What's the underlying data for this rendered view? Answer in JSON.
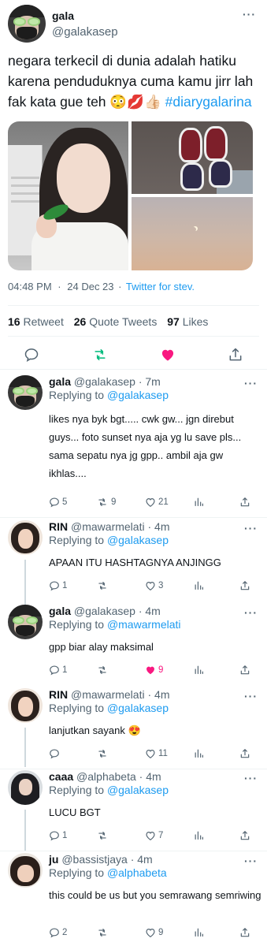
{
  "main_tweet": {
    "author_name": "gala",
    "author_handle": "@galakasep",
    "text_parts": {
      "body": "negara terkecil di dunia adalah hatiku karena penduduknya cuma kamu jirr lah fak kata gue teh 😳💋👍🏻 ",
      "hashtag": "#diarygalarina"
    },
    "time": "04:48 PM",
    "separator": "·",
    "date": "24 Dec 23",
    "source": "Twitter for stev.",
    "stats": [
      {
        "count": "16",
        "label": "Retweet"
      },
      {
        "count": "26",
        "label": "Quote Tweets"
      },
      {
        "count": "97",
        "label": "Likes"
      }
    ],
    "media": [
      "portrait-photo",
      "shoes-photo",
      "sunset-moon-photo"
    ]
  },
  "replies": [
    {
      "name": "gala",
      "handle": "@galakasep",
      "time": "· 7m",
      "replying_label": "Replying to",
      "replying_to": "@galakasep",
      "text": "likes nya byk bgt..... cwk gw... jgn direbut guys... foto sunset nya aja yg lu save pls... sama sepatu nya jg gpp.. ambil aja gw ikhlas....",
      "replies": "5",
      "retweets": "9",
      "likes": "21",
      "liked": false
    },
    {
      "name": "RIN",
      "handle": "@mawarmelati",
      "time": "· 4m",
      "replying_label": "Replying to",
      "replying_to": "@galakasep",
      "text": "APAAN ITU HASHTAGNYA ANJINGG",
      "replies": "1",
      "retweets": "",
      "likes": "3",
      "liked": false
    },
    {
      "name": "gala",
      "handle": "@galakasep",
      "time": "· 4m",
      "replying_label": "Replying to",
      "replying_to": "@mawarmelati",
      "text": "gpp biar alay maksimal",
      "replies": "1",
      "retweets": "",
      "likes": "9",
      "liked": true
    },
    {
      "name": "RIN",
      "handle": "@mawarmelati",
      "time": "· 4m",
      "replying_label": "Replying to",
      "replying_to": "@galakasep",
      "text": "lanjutkan sayank 😍",
      "replies": "",
      "retweets": "",
      "likes": "11",
      "liked": false
    },
    {
      "name": "caaa",
      "handle": "@alphabeta",
      "time": "· 4m",
      "replying_label": "Replying to",
      "replying_to": "@galakasep",
      "text": "LUCU BGT",
      "replies": "1",
      "retweets": "",
      "likes": "7",
      "liked": false
    },
    {
      "name": "ju",
      "handle": "@bassistjaya",
      "time": "· 4m",
      "replying_label": "Replying to",
      "replying_to": "@alphabeta",
      "text": "this could be us but you semrawang semriwing",
      "replies": "2",
      "retweets": "",
      "likes": "9",
      "liked": false
    }
  ],
  "icons": {
    "more": "more-icon",
    "reply": "reply-icon",
    "retweet": "retweet-icon",
    "like": "heart-icon",
    "share": "share-icon",
    "analytics": "analytics-icon"
  },
  "colors": {
    "accent": "#1d9bf0",
    "like": "#f91880",
    "retweet": "#00ba7c",
    "text": "#0f1419",
    "muted": "#536471"
  }
}
